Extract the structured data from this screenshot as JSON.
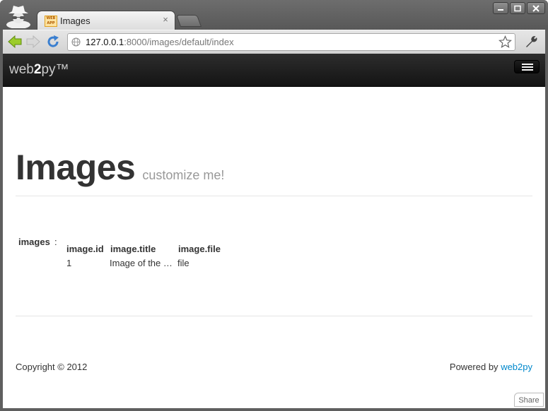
{
  "browser": {
    "tab_title": "Images",
    "favicon_text": "WEB APP",
    "url_host": "127.0.0.1",
    "url_rest": ":8000/images/default/index"
  },
  "navbar": {
    "brand_prefix": "web",
    "brand_bold": "2",
    "brand_suffix": "py™"
  },
  "header": {
    "title": "Images",
    "subtitle": "customize me!"
  },
  "form": {
    "label": "images",
    "colon": ":",
    "columns": [
      "image.id",
      "image.title",
      "image.file"
    ],
    "rows": [
      [
        "1",
        "Image of the …",
        "file"
      ]
    ]
  },
  "footer": {
    "copyright": "Copyright © 2012",
    "powered_by": "Powered by",
    "powered_link": "web2py"
  },
  "share_label": "Share",
  "colors": {
    "navbar": "#1b1b1b",
    "link": "#0088cc"
  }
}
